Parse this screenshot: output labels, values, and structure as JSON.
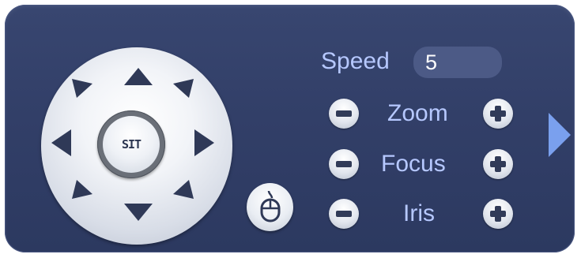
{
  "ptz": {
    "center_label": "SIT",
    "directions": [
      "up",
      "up-right",
      "right",
      "down-right",
      "down",
      "down-left",
      "left",
      "up-left"
    ]
  },
  "speed": {
    "label": "Speed",
    "value": "5"
  },
  "controls": {
    "zoom_label": "Zoom",
    "focus_label": "Focus",
    "iris_label": "Iris"
  },
  "icons": {
    "mouse": "mouse-icon",
    "expand": "expand-right-arrow-icon",
    "minus": "minus-icon",
    "plus": "plus-icon"
  },
  "colors": {
    "panel_background": "#323f68",
    "label_text": "#b6c8ff",
    "input_background": "#4c5a86",
    "arrow_dark": "#2f3957",
    "expand_arrow": "#7aa0ee"
  }
}
